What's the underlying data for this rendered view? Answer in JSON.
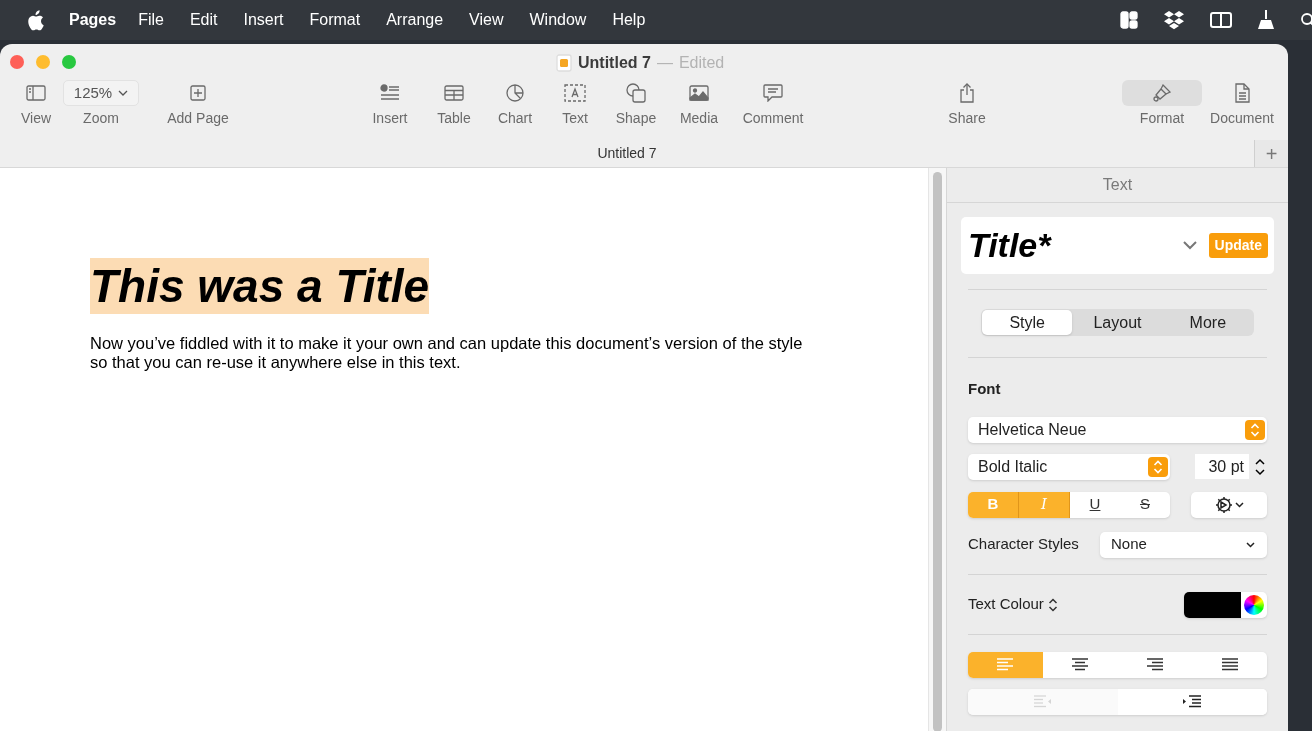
{
  "menu_bar": {
    "items": [
      {
        "label": "Pages",
        "kind": "app"
      },
      {
        "label": "File",
        "kind": "menu"
      },
      {
        "label": "Edit",
        "kind": "menu"
      },
      {
        "label": "Insert",
        "kind": "menu"
      },
      {
        "label": "Format",
        "kind": "menu"
      },
      {
        "label": "Arrange",
        "kind": "menu"
      },
      {
        "label": "View",
        "kind": "menu"
      },
      {
        "label": "Window",
        "kind": "menu"
      },
      {
        "label": "Help",
        "kind": "menu"
      }
    ]
  },
  "window": {
    "title": "Untitled 7",
    "separator": "—",
    "status": "Edited"
  },
  "toolbar": {
    "items": [
      {
        "label": "View",
        "kind": "view",
        "selected": false
      },
      {
        "label": "Zoom",
        "kind": "zoom",
        "value": "125%",
        "selected": false
      },
      {
        "label": "Add Page",
        "kind": "addpage",
        "selected": false
      },
      {
        "label": "Insert",
        "kind": "insert",
        "selected": false
      },
      {
        "label": "Table",
        "kind": "table",
        "selected": false
      },
      {
        "label": "Chart",
        "kind": "chart",
        "selected": false
      },
      {
        "label": "Text",
        "kind": "text",
        "selected": false
      },
      {
        "label": "Shape",
        "kind": "shape",
        "selected": false
      },
      {
        "label": "Media",
        "kind": "media",
        "selected": false
      },
      {
        "label": "Comment",
        "kind": "comment",
        "selected": false
      },
      {
        "label": "Share",
        "kind": "share",
        "selected": false
      },
      {
        "label": "Format",
        "kind": "format",
        "selected": true
      },
      {
        "label": "Document",
        "kind": "document",
        "selected": false
      }
    ]
  },
  "tab_bar": {
    "tabs": [
      {
        "label": "Untitled 7",
        "selected": true
      }
    ],
    "add_button": "+"
  },
  "document": {
    "title": "This was a Title",
    "title_selected": true,
    "body": "Now you’ve fiddled with it to make it your own and can update this document’s version of the style so that you can re-use it anywhere else in this text."
  },
  "sidebar": {
    "header": "Text",
    "style_name": "Title*",
    "update_button": "Update",
    "segments": [
      {
        "label": "Style",
        "selected": true
      },
      {
        "label": "Layout",
        "selected": false
      },
      {
        "label": "More",
        "selected": false
      }
    ],
    "font_label": "Font",
    "font_family": "Helvetica Neue",
    "typeface": "Bold Italic",
    "size": "30 pt",
    "style_buttons": [
      {
        "label": "B",
        "kind": "bold",
        "on": true
      },
      {
        "label": "I",
        "kind": "italic",
        "on": true
      },
      {
        "label": "U",
        "kind": "underline",
        "on": false
      },
      {
        "label": "S",
        "kind": "strike",
        "on": false
      }
    ],
    "character_styles": {
      "label": "Character Styles",
      "value": "None"
    },
    "text_colour": {
      "label": "Text Colour"
    },
    "alignment": [
      {
        "kind": "left",
        "selected": true
      },
      {
        "kind": "center",
        "selected": false
      },
      {
        "kind": "right",
        "selected": false
      },
      {
        "kind": "justify",
        "selected": false
      }
    ],
    "indent": [
      {
        "kind": "decrease",
        "disabled": true
      },
      {
        "kind": "increase",
        "disabled": false
      }
    ]
  }
}
